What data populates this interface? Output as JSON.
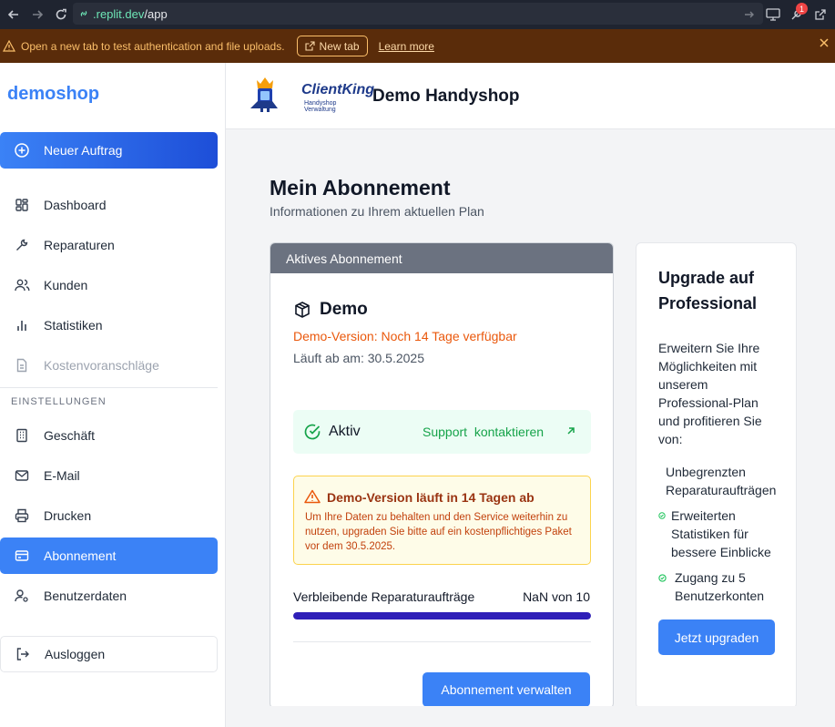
{
  "browser": {
    "url_host": ".replit.dev",
    "url_path": "/app",
    "notification_count": "1"
  },
  "warning_strip": {
    "message": "Open a new tab to test authentication and file uploads.",
    "new_tab_label": "New tab",
    "learn_more_label": "Learn more"
  },
  "sidebar": {
    "logo": "demoshop",
    "new_order_label": "Neuer Auftrag",
    "items": [
      {
        "label": "Dashboard",
        "icon": "dashboard-icon"
      },
      {
        "label": "Reparaturen",
        "icon": "wrench-icon"
      },
      {
        "label": "Kunden",
        "icon": "users-icon"
      },
      {
        "label": "Statistiken",
        "icon": "bar-chart-icon"
      },
      {
        "label": "Kostenvoranschläge",
        "icon": "document-icon"
      }
    ],
    "settings_label": "EINSTELLUNGEN",
    "settings_items": [
      {
        "label": "Geschäft",
        "icon": "building-icon"
      },
      {
        "label": "E-Mail",
        "icon": "mail-icon"
      },
      {
        "label": "Drucken",
        "icon": "printer-icon"
      },
      {
        "label": "Abonnement",
        "icon": "credit-card-icon"
      },
      {
        "label": "Benutzerdaten",
        "icon": "user-settings-icon"
      }
    ],
    "logout_label": "Ausloggen"
  },
  "header": {
    "brand_name": "ClientKing",
    "brand_sub": "Handyshop Verwaltung",
    "shop_title": "Demo Handyshop"
  },
  "main": {
    "title": "Mein Abonnement",
    "subtitle": "Informationen zu Ihrem aktuellen Plan",
    "subscription_card": {
      "header": "Aktives Abonnement",
      "plan_name": "Demo",
      "demo_notice": "Demo-Version: Noch 14 Tage verfügbar",
      "expires": "Läuft ab am: 30.5.2025",
      "status": "Aktiv",
      "support_label": "Support  kontaktieren",
      "alert_title": "Demo-Version läuft in 14 Tagen ab",
      "alert_text": "Um Ihre Daten zu behalten und den Service weiterhin zu nutzen, upgraden Sie bitte auf ein kostenpflichtiges Paket vor dem 30.5.2025.",
      "remaining_label": "Verbleibende Reparaturaufträge",
      "remaining_value": "NaN von 10",
      "progress_fraction": 1.0,
      "manage_label": "Abonnement verwalten"
    },
    "upgrade_card": {
      "title": "Upgrade auf Professional",
      "description": "Erweitern Sie Ihre Möglichkeiten mit unserem Professional-Plan und profitieren Sie von:",
      "features": [
        "Unbegrenzten Reparaturaufträgen",
        "Erweiterten Statistiken für bessere Einblicke",
        "Zugang zu 5 Benutzerkonten"
      ],
      "button_label": "Jetzt upgraden"
    }
  },
  "colors": {
    "accent": "#3b82f6",
    "warning_strip_bg": "#5a2c0a",
    "success": "#16a34a",
    "demo_orange": "#ea580c",
    "progress": "#2f1fb8"
  }
}
